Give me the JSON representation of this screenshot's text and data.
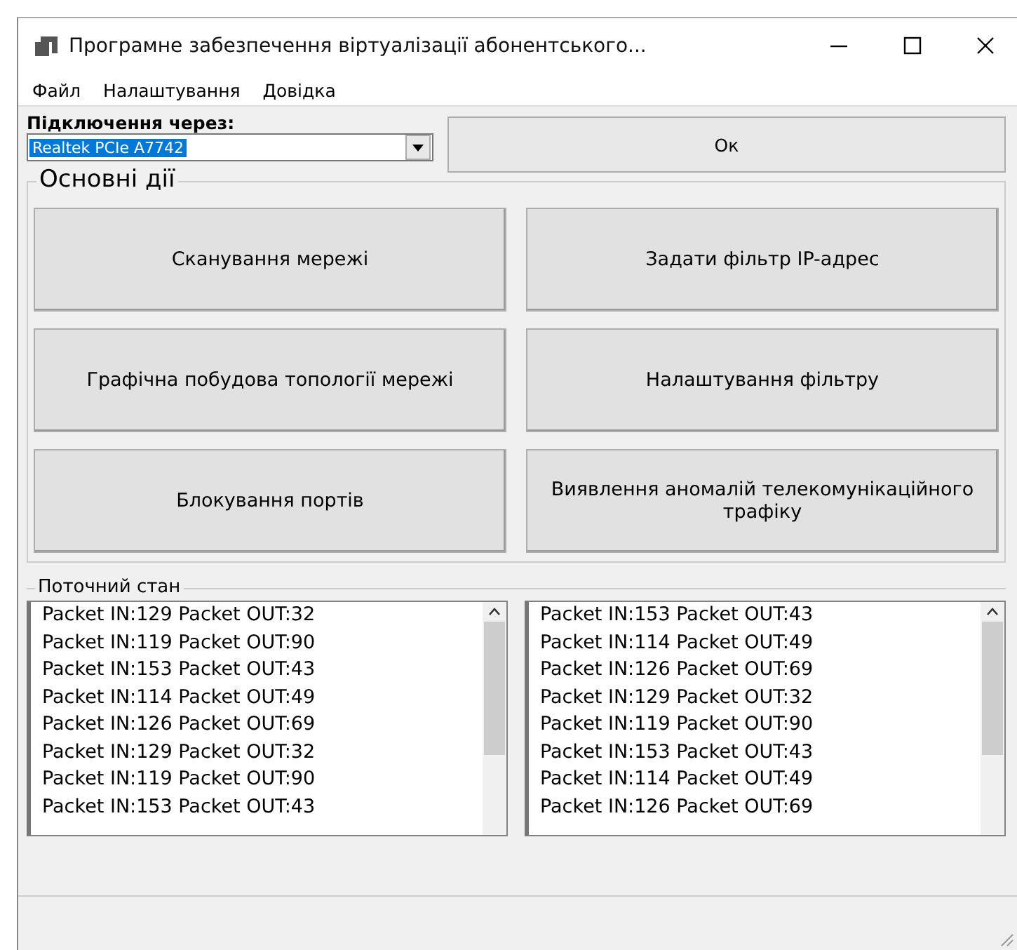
{
  "window": {
    "title": "Програмне забезпечення віртуалізації абонентського..."
  },
  "menu": [
    "Файл",
    "Налаштування",
    "Довідка"
  ],
  "connection": {
    "label": "Підключення через:",
    "value": "Realtek PCIe A7742",
    "button": "Ок"
  },
  "actions": {
    "title": "Основні дії",
    "buttons": [
      "Сканування мережі",
      "Задати фільтр IP-адрес",
      "Графічна побудова топології мережі",
      "Налаштування фільтру",
      "Блокування портів",
      "Виявлення аномалій телекомунікаційного трафіку"
    ]
  },
  "status": {
    "title": "Поточний стан",
    "lists": [
      [
        "Packet IN:129 Packet OUT:32",
        "Packet IN:119 Packet OUT:90",
        "Packet IN:153 Packet OUT:43",
        "Packet IN:114 Packet OUT:49",
        "Packet IN:126 Packet OUT:69",
        "Packet IN:129 Packet OUT:32",
        "Packet IN:119 Packet OUT:90",
        "Packet IN:153 Packet OUT:43"
      ],
      [
        "Packet IN:153 Packet OUT:43",
        "Packet IN:114 Packet OUT:49",
        "Packet IN:126 Packet OUT:69",
        "Packet IN:129 Packet OUT:32",
        "Packet IN:119 Packet OUT:90",
        "Packet IN:153 Packet OUT:43",
        "Packet IN:114 Packet OUT:49",
        "Packet IN:126 Packet OUT:69"
      ]
    ]
  }
}
